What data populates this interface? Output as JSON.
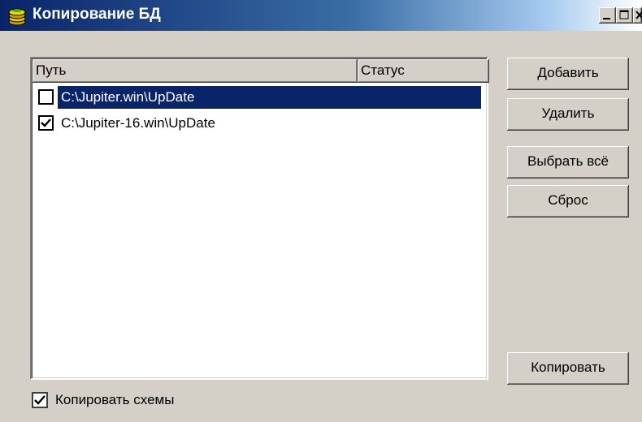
{
  "window": {
    "title": "Копирование БД",
    "app_icon": "database-icon",
    "caption_buttons": [
      "minimize-icon",
      "maximize-icon",
      "close-icon"
    ]
  },
  "list": {
    "columns": [
      "Путь",
      "Статус"
    ],
    "rows": [
      {
        "checked": false,
        "path": "C:\\Jupiter.win\\UpDate",
        "status": "",
        "selected": true
      },
      {
        "checked": true,
        "path": "C:\\Jupiter-16.win\\UpDate",
        "status": "",
        "selected": false
      }
    ]
  },
  "buttons": {
    "add": "Добавить",
    "delete": "Удалить",
    "select_all": "Выбрать всё",
    "reset": "Сброс",
    "copy": "Копировать"
  },
  "options": {
    "copy_schemas_label": "Копировать схемы",
    "copy_schemas_checked": true
  },
  "colors": {
    "selection": "#0a246a",
    "face": "#d4d0c8"
  }
}
